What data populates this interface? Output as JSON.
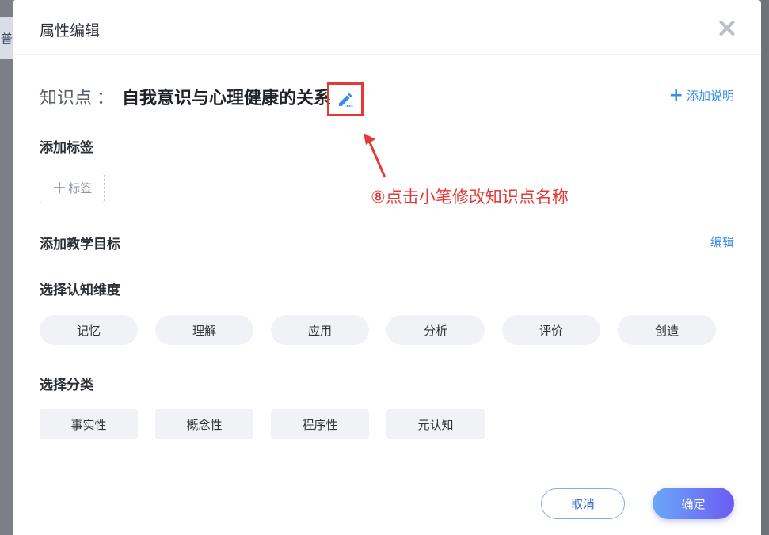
{
  "backdrop": {
    "partial_char": "普"
  },
  "dialog": {
    "title": "属性编辑",
    "close_icon": "close-icon"
  },
  "knowledge_point": {
    "label": "知识点",
    "separator": "：",
    "name": "自我意识与心理健康的关系",
    "edit_icon": "pencil-icon",
    "add_description": "添加说明"
  },
  "tags": {
    "section_title": "添加标签",
    "add_tag": "标签"
  },
  "teaching_goal": {
    "section_title": "添加教学目标",
    "edit_link": "编辑"
  },
  "cognitive_dimension": {
    "section_title": "选择认知维度",
    "options": [
      "记忆",
      "理解",
      "应用",
      "分析",
      "评价",
      "创造"
    ]
  },
  "classification": {
    "section_title": "选择分类",
    "options": [
      "事实性",
      "概念性",
      "程序性",
      "元认知"
    ]
  },
  "annotation": {
    "text": "⑧点击小笔修改知识点名称",
    "color": "#e53935"
  },
  "footer": {
    "cancel": "取消",
    "confirm": "确定"
  },
  "colors": {
    "accent": "#3a8ee6",
    "confirm_gradient_start": "#6aa8f7",
    "confirm_gradient_end": "#6a5cf2"
  }
}
